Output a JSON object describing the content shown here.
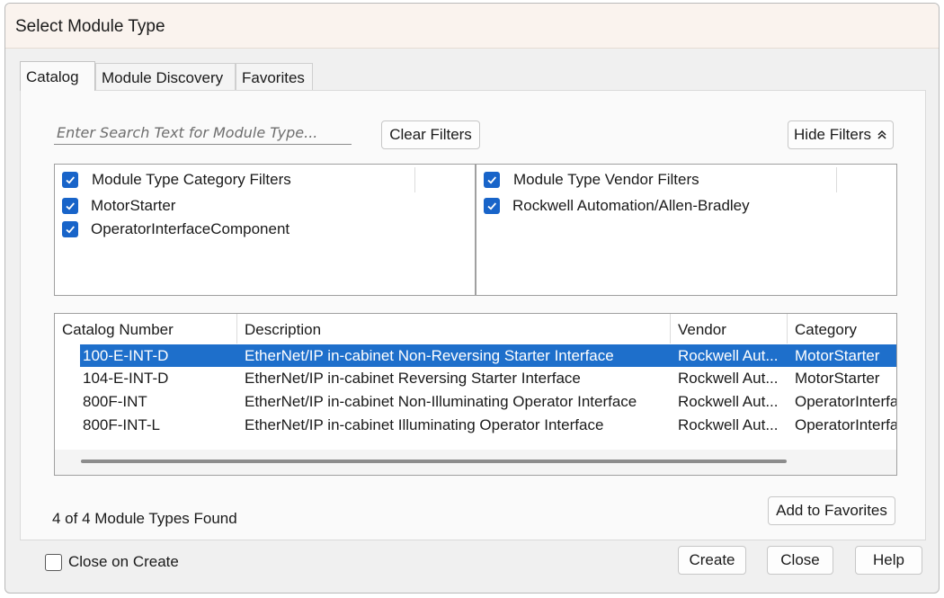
{
  "window": {
    "title": "Select Module Type"
  },
  "tabs": [
    {
      "label": "Catalog",
      "active": true
    },
    {
      "label": "Module Discovery",
      "active": false
    },
    {
      "label": "Favorites",
      "active": false
    }
  ],
  "search": {
    "placeholder": "Enter Search Text for Module Type..."
  },
  "buttons": {
    "clear_filters": "Clear Filters",
    "hide_filters": "Hide Filters",
    "add_favorites": "Add to Favorites",
    "create": "Create",
    "close": "Close",
    "help": "Help"
  },
  "category_filters": {
    "header": "Module Type Category Filters",
    "items": [
      {
        "label": "MotorStarter",
        "checked": true
      },
      {
        "label": "OperatorInterfaceComponent",
        "checked": true
      }
    ]
  },
  "vendor_filters": {
    "header": "Module Type Vendor Filters",
    "items": [
      {
        "label": "Rockwell Automation/Allen-Bradley",
        "checked": true
      }
    ]
  },
  "table": {
    "columns": [
      "Catalog Number",
      "Description",
      "Vendor",
      "Category"
    ],
    "rows": [
      {
        "catalog": "100-E-INT-D",
        "description": "EtherNet/IP in-cabinet Non-Reversing Starter Interface",
        "vendor": "Rockwell Aut...",
        "category": "MotorStarter",
        "selected": true
      },
      {
        "catalog": "104-E-INT-D",
        "description": "EtherNet/IP in-cabinet Reversing Starter Interface",
        "vendor": "Rockwell Aut...",
        "category": "MotorStarter",
        "selected": false
      },
      {
        "catalog": "800F-INT",
        "description": "EtherNet/IP in-cabinet Non-Illuminating Operator Interface",
        "vendor": "Rockwell Aut...",
        "category": "OperatorInterfa",
        "selected": false
      },
      {
        "catalog": "800F-INT-L",
        "description": "EtherNet/IP in-cabinet Illuminating Operator Interface",
        "vendor": "Rockwell Aut...",
        "category": "OperatorInterfa",
        "selected": false
      }
    ]
  },
  "status": "4 of 4 Module Types Found",
  "close_on_create": {
    "label": "Close on Create",
    "checked": false
  },
  "colors": {
    "accent": "#1864c9",
    "selection": "#1e6fcb"
  },
  "icons": {
    "hide_filters": "double-chevron-up-icon",
    "checkbox": "checkmark-icon"
  }
}
